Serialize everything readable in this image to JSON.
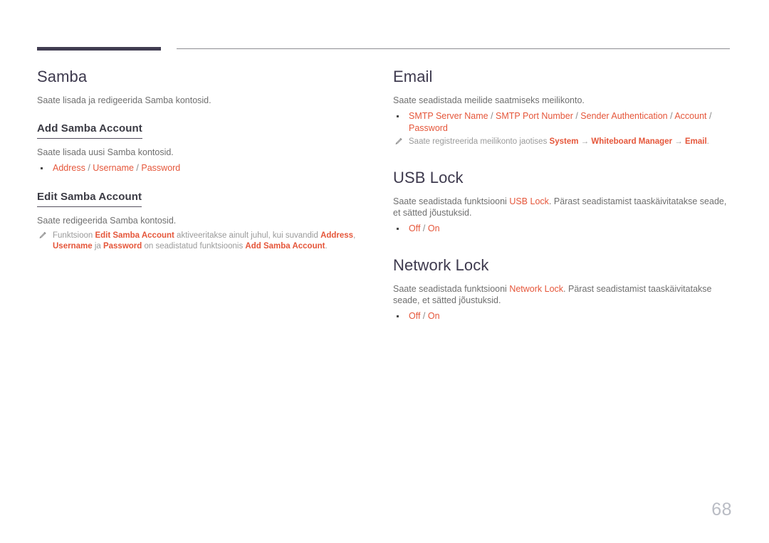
{
  "page": {
    "number": "68"
  },
  "left_column": {
    "sections": [
      {
        "title": "Samba",
        "intro": "Saate lisada ja redigeerida Samba kontosid.",
        "subsections": [
          {
            "title": "Add Samba Account",
            "body": "Saate lisada uusi Samba kontosid.",
            "bullet": {
              "item1": "Address",
              "sep1": " / ",
              "item2": "Username",
              "sep2": " / ",
              "item3": "Password"
            }
          },
          {
            "title": "Edit Samba Account",
            "body": "Saate redigeerida Samba kontosid.",
            "note": {
              "t1": "Funktsioon ",
              "s1": "Edit Samba Account",
              "t2": " aktiveeritakse ainult juhul, kui suvandid ",
              "s2": "Address",
              "t3": ", ",
              "s3": "Username",
              "t4": " ja ",
              "s4": "Password",
              "t5": " on seadistatud funktsioonis ",
              "s5": "Add Samba Account",
              "t6": "."
            }
          }
        ]
      }
    ]
  },
  "right_column": {
    "sections": [
      {
        "title": "Email",
        "intro": "Saate seadistada meilide saatmiseks meilikonto.",
        "bullet": {
          "item1": "SMTP Server Name",
          "sep1": " / ",
          "item2": "SMTP Port Number",
          "sep2": " / ",
          "item3": "Sender Authentication",
          "sep3": " / ",
          "item4": "Account",
          "sep4": " / ",
          "item5": "Password"
        },
        "note": {
          "t1": "Saate registreerida meilikonto jaotises ",
          "s1": "System",
          "t2": " → ",
          "s2": "Whiteboard Manager",
          "t3": " → ",
          "s3": "Email",
          "t4": "."
        }
      },
      {
        "title": "USB Lock",
        "body": {
          "t1": "Saate seadistada funktsiooni ",
          "s1": "USB Lock",
          "t2": ". Pärast seadistamist taaskäivitatakse seade, et sätted jõustuksid."
        },
        "bullet": {
          "item1": "Off",
          "sep1": " / ",
          "item2": "On"
        }
      },
      {
        "title": "Network Lock",
        "body": {
          "t1": "Saate seadistada funktsiooni ",
          "s1": "Network Lock",
          "t2": ". Pärast seadistamist taaskäivitatakse seade, et sätted jõustuksid."
        },
        "bullet": {
          "item1": "Off",
          "sep1": " / ",
          "item2": "On"
        }
      }
    ]
  }
}
